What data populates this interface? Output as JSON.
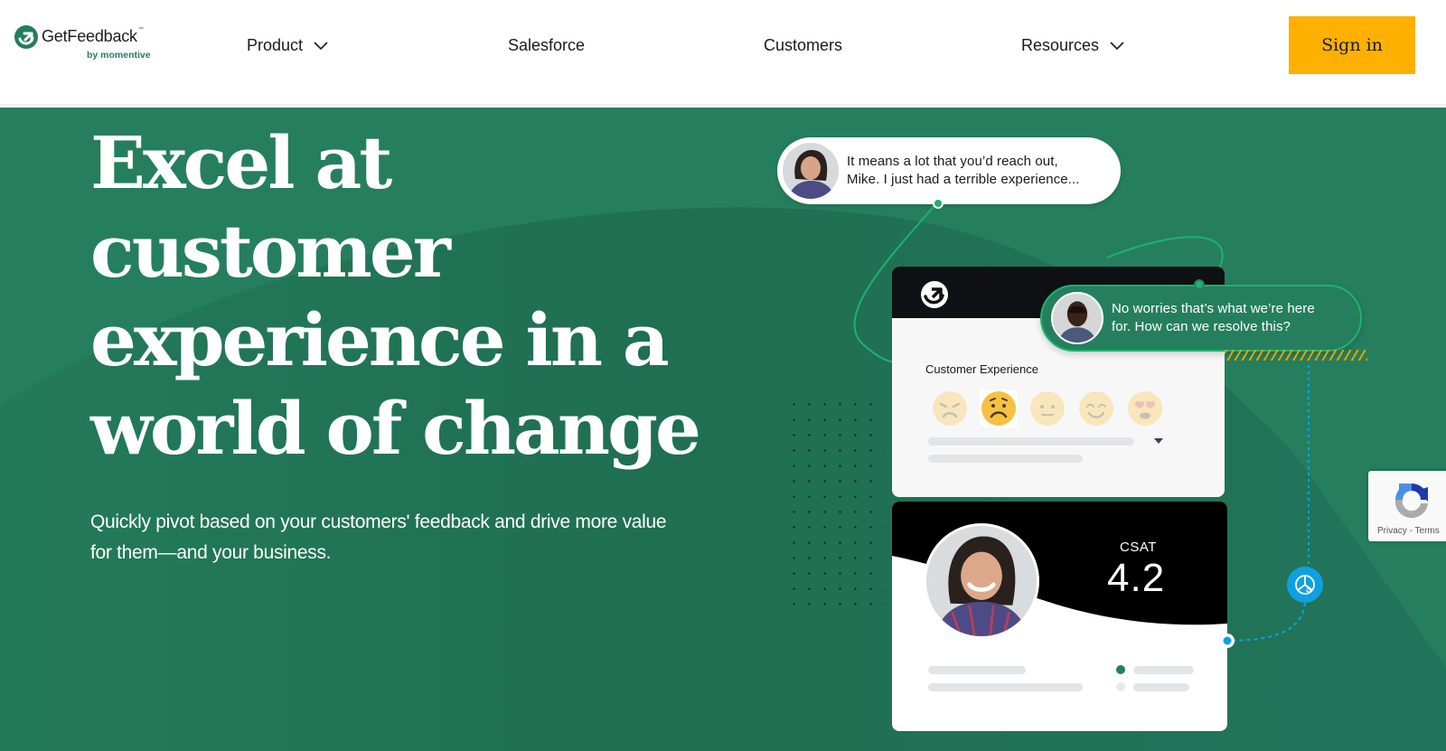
{
  "header": {
    "brand": "GetFeedback",
    "brand_tm": "™",
    "brand_sub": "by momentive",
    "nav": [
      {
        "label": "Product",
        "has_dropdown": true
      },
      {
        "label": "Salesforce",
        "has_dropdown": false
      },
      {
        "label": "Customers",
        "has_dropdown": false
      },
      {
        "label": "Resources",
        "has_dropdown": true
      }
    ],
    "signin_label": "Sign in"
  },
  "hero": {
    "headline_lines": [
      "Excel at",
      "customer",
      "experience in a",
      "world of change"
    ],
    "subtext": "Quickly pivot based on your customers' feedback and drive more value for them—and your business."
  },
  "illustration": {
    "bubble_customer": {
      "line1": "It means a lot that you’d reach out,",
      "line2": "Mike. I just had a terrible experience..."
    },
    "bubble_agent": {
      "line1": "No worries that’s what we’re here",
      "line2": "for. How can we resolve this?"
    },
    "survey": {
      "title": "Customer Experience",
      "emoji_options": [
        "angry",
        "worried",
        "neutral",
        "happy",
        "love"
      ],
      "selected_emoji": "worried"
    },
    "csat": {
      "label": "CSAT",
      "value": "4.2"
    }
  },
  "recaptcha": {
    "privacy": "Privacy",
    "separator": " - ",
    "terms": "Terms"
  },
  "colors": {
    "brand_green": "#257f5e",
    "accent_green": "#1cb36e",
    "signin_yellow": "#fdb000",
    "info_blue": "#0ea1e0"
  }
}
